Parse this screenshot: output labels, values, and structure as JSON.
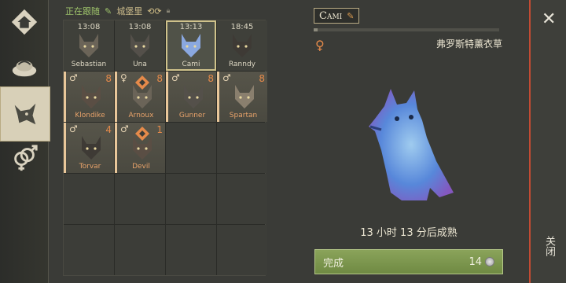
{
  "header": {
    "following_label": "正在跟随",
    "location_label": "城堡里"
  },
  "grid": [
    {
      "type": "baby",
      "time": "13:08",
      "name": "Sebastian"
    },
    {
      "type": "baby",
      "time": "13:08",
      "name": "Una"
    },
    {
      "type": "baby",
      "time": "13:13",
      "name": "Cami",
      "selected": true
    },
    {
      "type": "baby",
      "time": "18:45",
      "name": "Ranndy"
    },
    {
      "type": "adult",
      "sex": "♂",
      "num": "8",
      "name": "Klondike"
    },
    {
      "type": "adult",
      "sex": "♀",
      "num": "8",
      "name": "Arnoux",
      "badge": true
    },
    {
      "type": "adult",
      "sex": "♂",
      "num": "8",
      "name": "Gunner"
    },
    {
      "type": "adult",
      "sex": "♂",
      "num": "8",
      "name": "Spartan"
    },
    {
      "type": "adult",
      "sex": "♂",
      "num": "4",
      "name": "Torvar"
    },
    {
      "type": "adult",
      "sex": "♂",
      "num": "1",
      "name": "Devil",
      "badge": true
    }
  ],
  "detail": {
    "name": "Cami",
    "gender_symbol": "♀",
    "location": "弗罗斯特薰衣草",
    "maturity_status": "13 小时 13 分后成熟",
    "progress_fraction": 0.02,
    "done_label": "完成",
    "cost": "14"
  },
  "close": {
    "label": "关闭"
  },
  "colors": {
    "accent_orange": "#e58a4a",
    "button_green": "#7f9a4f",
    "close_red": "#c24b33"
  }
}
